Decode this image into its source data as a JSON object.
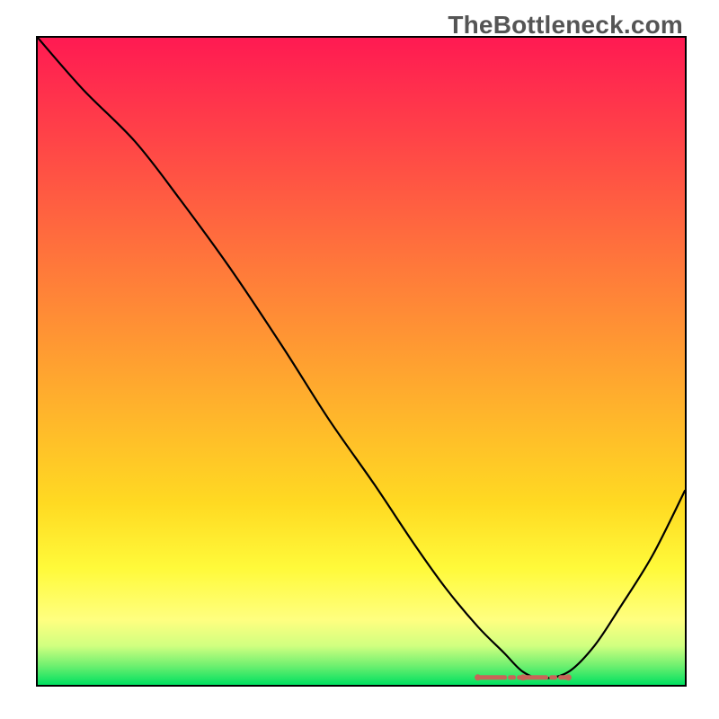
{
  "watermark": "TheBottleneck.com",
  "chart_data": {
    "type": "line",
    "title": "",
    "xlabel": "",
    "ylabel": "",
    "xlim": [
      0,
      100
    ],
    "ylim": [
      0,
      100
    ],
    "x": [
      0,
      7,
      15,
      22,
      30,
      38,
      45,
      52,
      58,
      63,
      68,
      72,
      75,
      78,
      82,
      86,
      90,
      95,
      100
    ],
    "values": [
      100,
      92,
      84,
      75,
      64,
      52,
      41,
      31,
      22,
      15,
      9,
      5,
      2,
      1,
      2,
      6,
      12,
      20,
      30
    ],
    "flat_region_x": [
      68,
      82
    ],
    "flat_region_color": "#c86458",
    "gradient_description": "red-to-yellow-to-green vertical"
  }
}
